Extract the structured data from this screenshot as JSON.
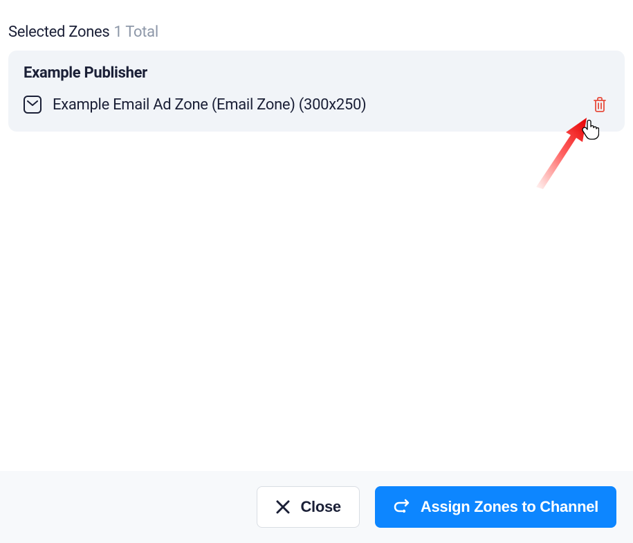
{
  "header": {
    "title": "Selected Zones",
    "count": "1 Total"
  },
  "zone_card": {
    "publisher": "Example Publisher",
    "items": [
      {
        "name": "Example Email Ad Zone (Email Zone) (300x250)"
      }
    ]
  },
  "footer": {
    "close_label": "Close",
    "assign_label": "Assign Zones to Channel"
  }
}
